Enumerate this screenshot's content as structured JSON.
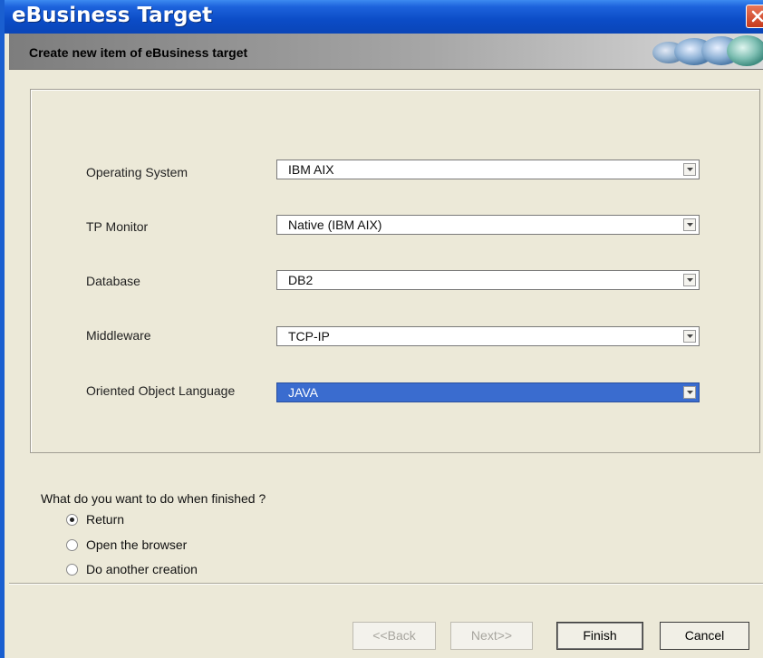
{
  "window": {
    "title": "eBusiness Target",
    "subheader": "Create new item of eBusiness target"
  },
  "form": {
    "fields": [
      {
        "label": "Operating System",
        "value": "IBM AIX"
      },
      {
        "label": "TP Monitor",
        "value": "Native (IBM AIX)"
      },
      {
        "label": "Database",
        "value": "DB2"
      },
      {
        "label": "Middleware",
        "value": "TCP-IP"
      },
      {
        "label": "Oriented Object Language",
        "value": "JAVA"
      }
    ]
  },
  "finish_options": {
    "question": "What do you want to do when finished ?",
    "options": [
      "Return",
      "Open the browser",
      "Do another creation"
    ],
    "selected": "Return"
  },
  "buttons": {
    "back": "<<Back",
    "next": "Next>>",
    "finish": "Finish",
    "cancel": "Cancel"
  },
  "icons": {
    "close": "close-icon",
    "dropdown": "dropdown-arrow-icon",
    "header_decoration": "globe-decoration-icon"
  },
  "colors": {
    "titlebar": "#0a45b8",
    "selected_field": "#3a6ccf",
    "close_button": "#c63a1c"
  }
}
